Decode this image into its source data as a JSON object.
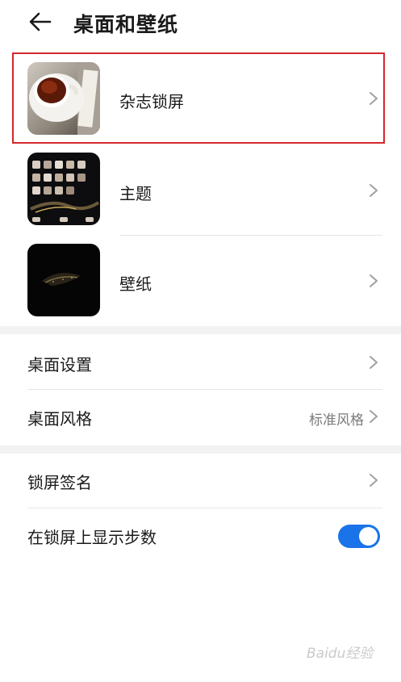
{
  "header": {
    "title": "桌面和壁纸",
    "back_icon": "arrow-left-icon"
  },
  "thumb_items": [
    {
      "label": "杂志锁屏",
      "thumbnail": "magazine-lockscreen-thumbnail",
      "highlighted": true
    },
    {
      "label": "主题",
      "thumbnail": "theme-thumbnail"
    },
    {
      "label": "壁纸",
      "thumbnail": "wallpaper-thumbnail"
    }
  ],
  "settings": {
    "desktop_settings": {
      "label": "桌面设置"
    },
    "desktop_style": {
      "label": "桌面风格",
      "value": "标准风格"
    },
    "lockscreen_signature": {
      "label": "锁屏签名"
    },
    "show_steps": {
      "label": "在锁屏上显示步数",
      "enabled": true
    }
  },
  "colors": {
    "highlight_border": "#d4262b",
    "toggle_on": "#1a73e8",
    "divider": "#e6e6e6",
    "section_gap": "#f2f2f2"
  },
  "watermark": {
    "text": "Baidu经验"
  }
}
